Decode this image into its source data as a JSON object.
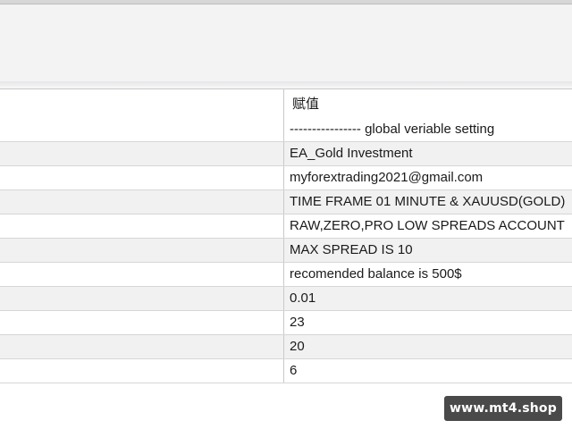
{
  "table": {
    "header": {
      "value_label": "赋值"
    },
    "rows": [
      {
        "value": "---------------- global veriable setting"
      },
      {
        "value": "EA_Gold Investment"
      },
      {
        "value": "myforextrading2021@gmail.com"
      },
      {
        "value": "TIME FRAME 01 MINUTE & XAUUSD(GOLD)"
      },
      {
        "value": "RAW,ZERO,PRO LOW SPREADS ACCOUNT"
      },
      {
        "value": " MAX SPREAD IS 10"
      },
      {
        "value": " recomended balance is 500$"
      },
      {
        "value": "0.01"
      },
      {
        "value": "23"
      },
      {
        "value": "20"
      },
      {
        "value": "6"
      }
    ]
  },
  "watermark": {
    "text": "www.mt4.shop"
  }
}
